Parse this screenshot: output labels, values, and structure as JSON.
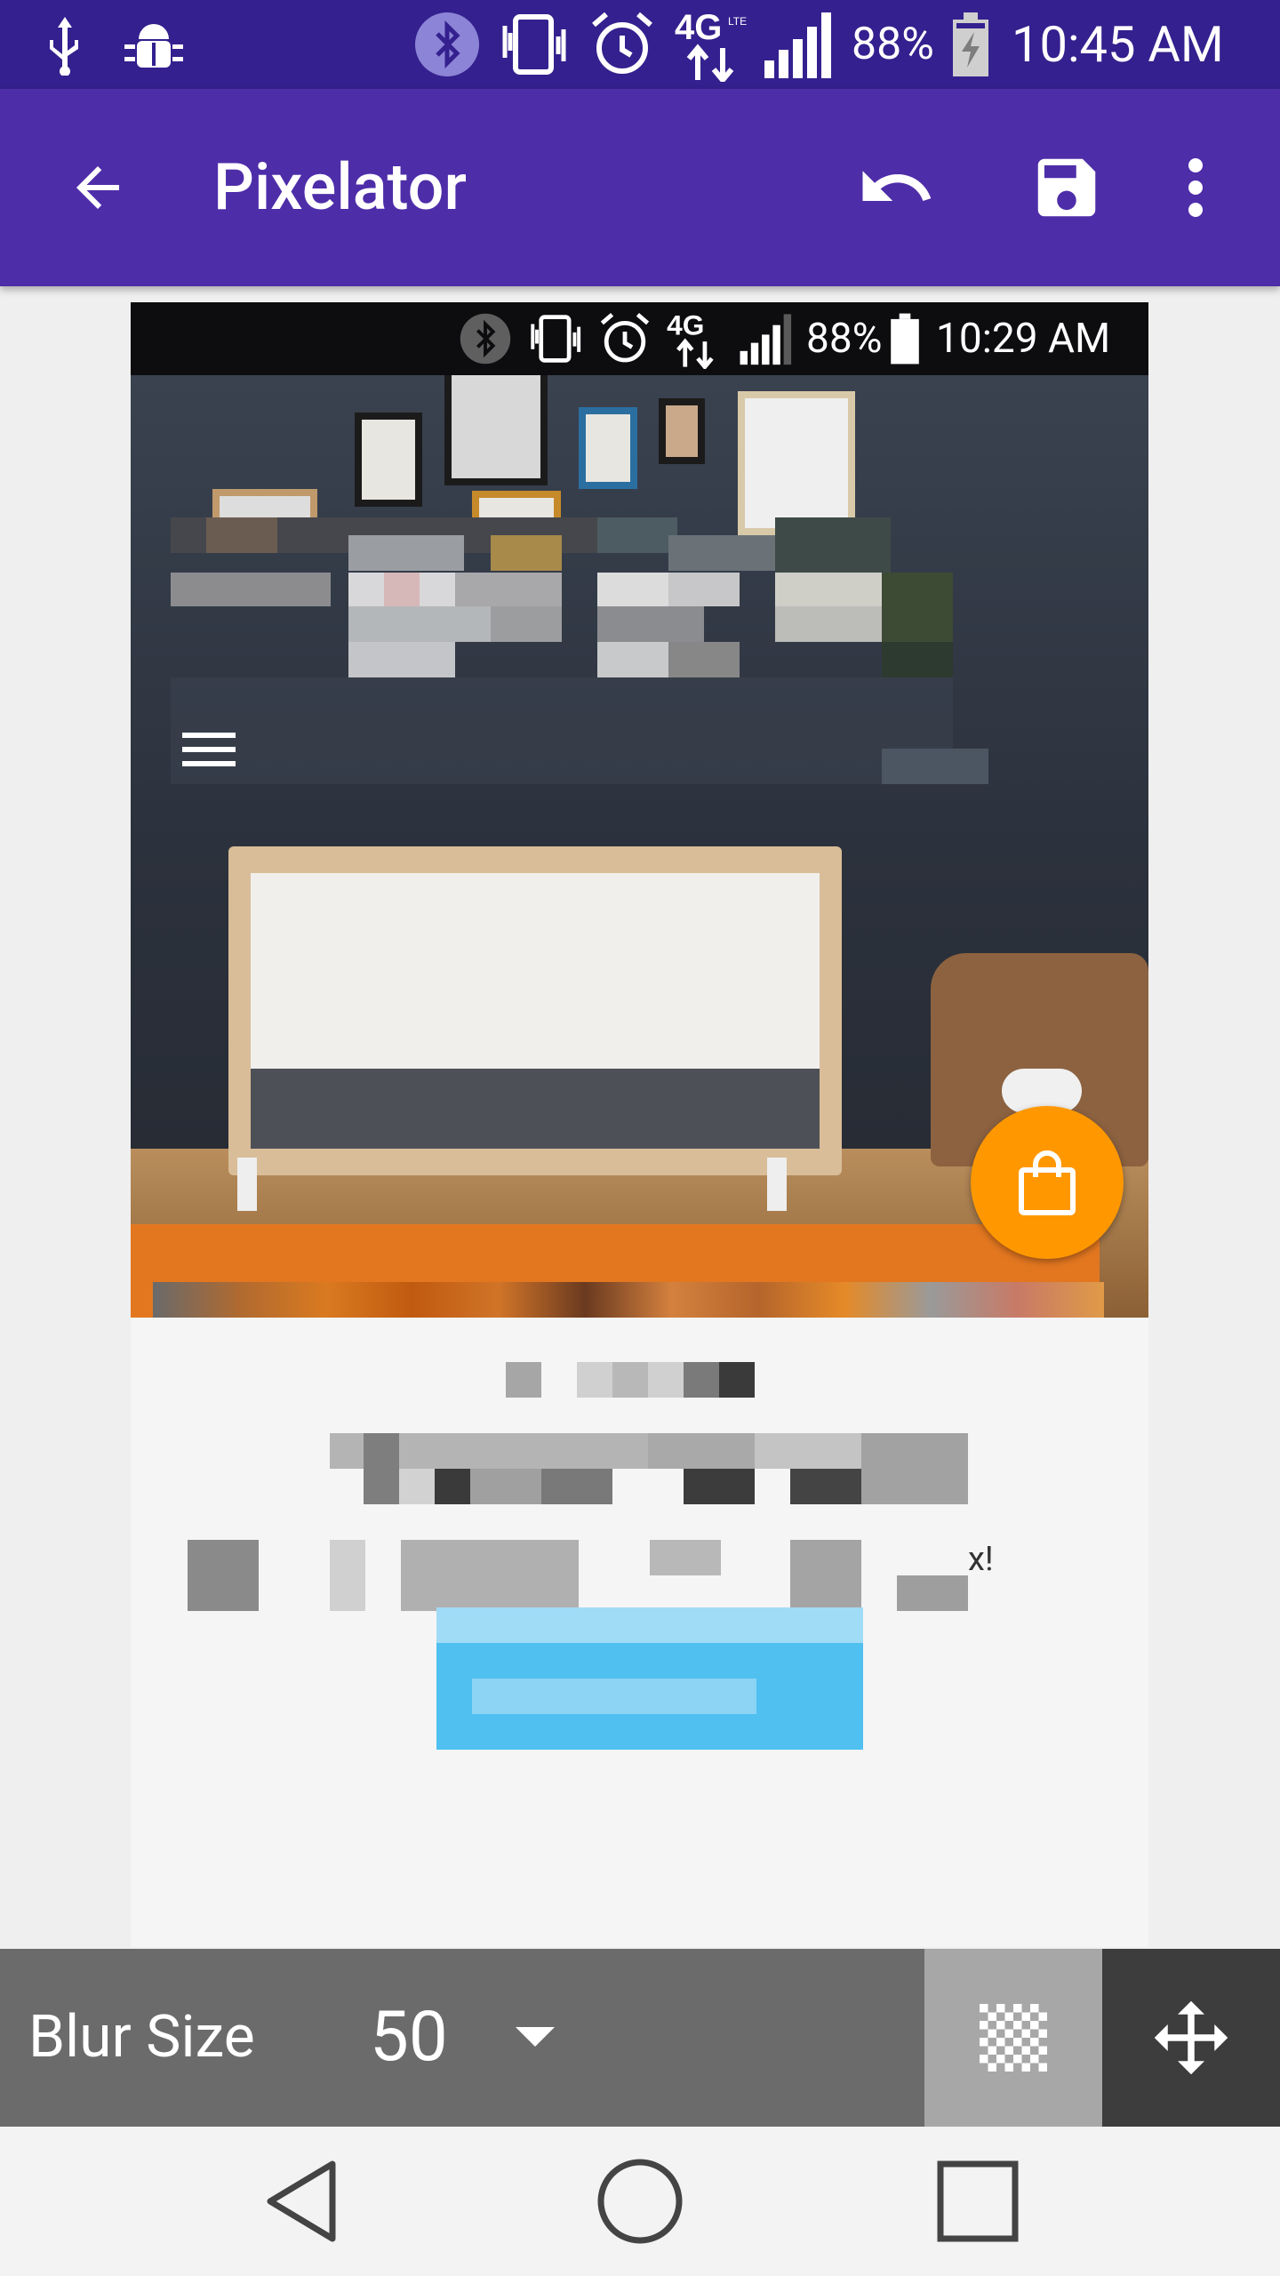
{
  "status_bar": {
    "battery": "88%",
    "time": "10:45 AM",
    "network": "4G",
    "icons": [
      "usb-icon",
      "android-debug-icon",
      "bluetooth-icon",
      "vibrate-icon",
      "alarm-icon",
      "network-4g-lte-icon",
      "signal-icon",
      "battery-charging-icon"
    ]
  },
  "app_bar": {
    "title": "Pixelator",
    "back_icon": "arrow-back-icon",
    "undo_icon": "undo-icon",
    "save_icon": "save-icon",
    "overflow_icon": "more-vert-icon"
  },
  "canvas": {
    "status_bar": {
      "battery": "88%",
      "time": "10:29 AM",
      "network": "4G"
    },
    "fab_icon": "shopping-bag-icon",
    "fab_color": "#ff9800",
    "button_color": "#4fc0f0",
    "partial_text": "x!"
  },
  "bottom_bar": {
    "label": "Blur Size",
    "value": "50",
    "pixelate_icon": "checkerboard-icon",
    "move_icon": "move-arrows-icon"
  },
  "nav_bar": {
    "back_icon": "nav-back-icon",
    "home_icon": "nav-home-icon",
    "recents_icon": "nav-recents-icon"
  },
  "colors": {
    "status_bar": "#34208e",
    "app_bar": "#4e2da9",
    "bottom_bar": "#6b6b6b"
  }
}
